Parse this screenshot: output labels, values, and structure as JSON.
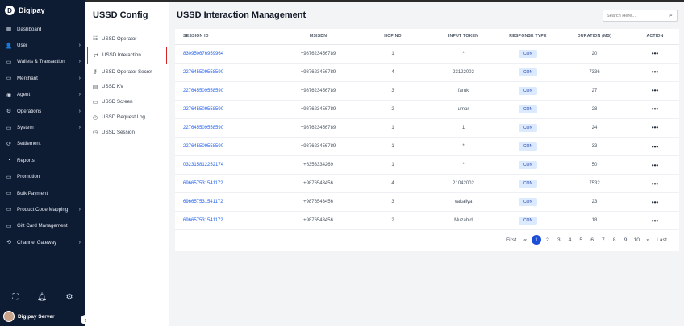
{
  "brand": {
    "name": "Digipay",
    "logo": "D"
  },
  "sidebar": {
    "items": [
      {
        "label": "Dashboard",
        "icon": "dashboard-icon",
        "glyph": "▦",
        "chevron": false
      },
      {
        "label": "User",
        "icon": "user-icon",
        "glyph": "👤",
        "chevron": true
      },
      {
        "label": "Wallets & Transaction",
        "icon": "wallet-icon",
        "glyph": "▭",
        "chevron": true
      },
      {
        "label": "Merchant",
        "icon": "merchant-icon",
        "glyph": "▭",
        "chevron": true
      },
      {
        "label": "Agent",
        "icon": "agent-icon",
        "glyph": "◉",
        "chevron": true
      },
      {
        "label": "Operations",
        "icon": "operations-icon",
        "glyph": "⚙",
        "chevron": true
      },
      {
        "label": "System",
        "icon": "system-icon",
        "glyph": "▭",
        "chevron": true
      },
      {
        "label": "Settlement",
        "icon": "settlement-icon",
        "glyph": "⟳",
        "chevron": false
      },
      {
        "label": "Reports",
        "icon": "reports-icon",
        "glyph": "◔",
        "chevron": false
      },
      {
        "label": "Promotion",
        "icon": "promotion-icon",
        "glyph": "▭",
        "chevron": false
      },
      {
        "label": "Bulk Payment",
        "icon": "bulk-payment-icon",
        "glyph": "▭",
        "chevron": false
      },
      {
        "label": "Product Code Mapping",
        "icon": "product-code-icon",
        "glyph": "▭",
        "chevron": true
      },
      {
        "label": "Gift Card Management",
        "icon": "gift-card-icon",
        "glyph": "▭",
        "chevron": false
      },
      {
        "label": "Channel Gateway",
        "icon": "channel-gateway-icon",
        "glyph": "⟲",
        "chevron": true
      }
    ],
    "user_name": "Digipay Server"
  },
  "config": {
    "title": "USSD Config",
    "items": [
      {
        "label": "USSD Operator",
        "glyph": "☷"
      },
      {
        "label": "USSD Interaction",
        "glyph": "⇄"
      },
      {
        "label": "USSD Operator Secret",
        "glyph": "⚷"
      },
      {
        "label": "USSD KV",
        "glyph": "▤"
      },
      {
        "label": "USSD Screen",
        "glyph": "▭"
      },
      {
        "label": "USSD Request Log",
        "glyph": "◷"
      },
      {
        "label": "USSD Session",
        "glyph": "◷"
      }
    ],
    "active_index": 1
  },
  "main": {
    "title": "USSD Interaction Management",
    "search_placeholder": "Search Here...",
    "table": {
      "headers": [
        "SESSION ID",
        "MSISDN",
        "HOP NO",
        "INPUT TOKEN",
        "RESPONSE TYPE",
        "DURATION (MS)",
        "ACTION"
      ],
      "rows": [
        [
          "830950676959964",
          "+987623456789",
          "1",
          "*",
          "CON",
          "20"
        ],
        [
          "227645509558590",
          "+987623456789",
          "4",
          "23122002",
          "CON",
          "7336"
        ],
        [
          "227645509558590",
          "+987623456789",
          "3",
          "faruk",
          "CON",
          "27"
        ],
        [
          "227645509558590",
          "+987623456789",
          "2",
          "umar",
          "CON",
          "28"
        ],
        [
          "227645509558590",
          "+987623456789",
          "1",
          "1",
          "CON",
          "24"
        ],
        [
          "227645509558590",
          "+987623456789",
          "1",
          "*",
          "CON",
          "33"
        ],
        [
          "032315812252174",
          "+6353334269",
          "1",
          "*",
          "CON",
          "50"
        ],
        [
          "696657531541172",
          "+9876543456",
          "4",
          "21042002",
          "CON",
          "7532"
        ],
        [
          "696657531541172",
          "+9876543456",
          "3",
          "vakaliya",
          "CON",
          "23"
        ],
        [
          "696657531541172",
          "+9876543456",
          "2",
          "Muzahid",
          "CON",
          "18"
        ]
      ],
      "action_glyph": "•••"
    },
    "pagination": {
      "first": "First",
      "prev": "«",
      "pages": [
        "1",
        "2",
        "3",
        "4",
        "5",
        "6",
        "7",
        "8",
        "9",
        "10"
      ],
      "current": "1",
      "next": "»",
      "last": "Last"
    }
  }
}
